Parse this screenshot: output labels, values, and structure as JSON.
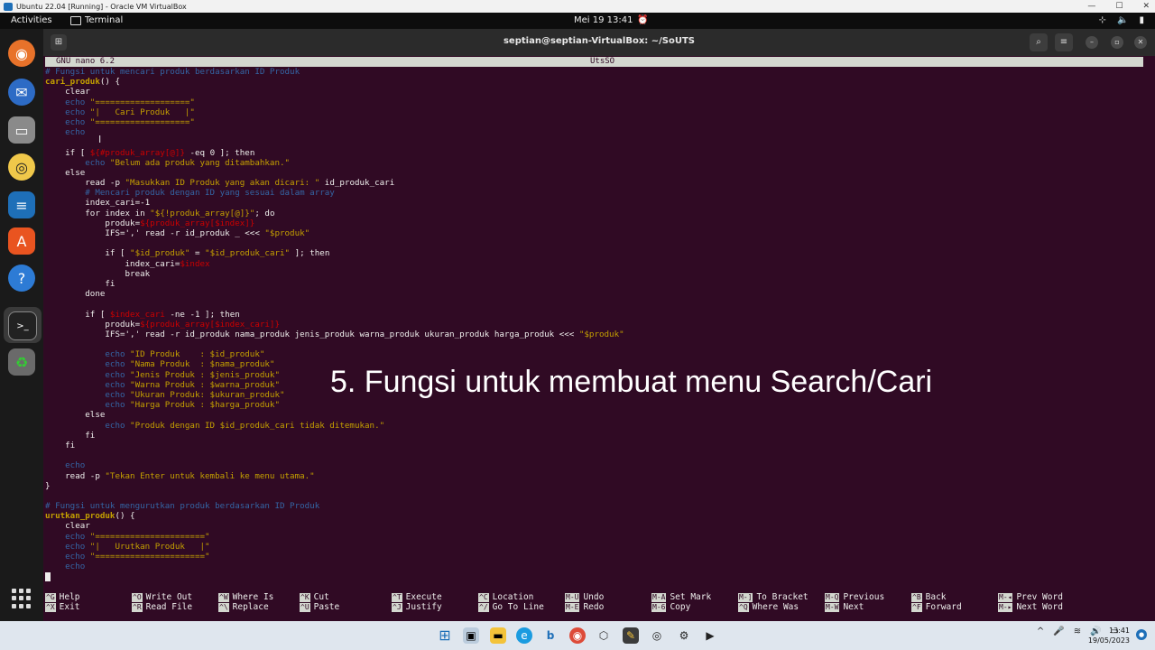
{
  "vbox": {
    "title": "Ubuntu 22.04 [Running] - Oracle VM VirtualBox",
    "minimize": "—",
    "restore": "☐",
    "close": "✕"
  },
  "topbar": {
    "activities": "Activities",
    "app_name": "Terminal",
    "clock": "Mei 19  13:41"
  },
  "terminal": {
    "title": "septian@septian-VirtualBox: ~/SoUTS"
  },
  "nano": {
    "version": "GNU nano 6.2",
    "filename": "UtsSO"
  },
  "editor_lines": [
    [
      [
        "c-cm",
        "# Fungsi untuk mencari produk berdasarkan ID Produk"
      ]
    ],
    [
      [
        "c-fn",
        "cari_produk"
      ],
      [
        "",
        "() {"
      ]
    ],
    [
      [
        "",
        "    clear"
      ]
    ],
    [
      [
        "c-echo",
        "    echo "
      ],
      [
        "c-str",
        "\"===================\""
      ]
    ],
    [
      [
        "c-echo",
        "    echo "
      ],
      [
        "c-str",
        "\"|   Cari Produk   |\""
      ]
    ],
    [
      [
        "c-echo",
        "    echo "
      ],
      [
        "c-str",
        "\"===================\""
      ]
    ],
    [
      [
        "c-echo",
        "    echo"
      ]
    ],
    [
      [
        "",
        ""
      ]
    ],
    [
      [
        "",
        "    if [ "
      ],
      [
        "c-var",
        "${#produk_array[@]}"
      ],
      [
        "",
        " -eq 0 ]; then"
      ]
    ],
    [
      [
        "c-echo",
        "        echo "
      ],
      [
        "c-str",
        "\"Belum ada produk yang ditambahkan.\""
      ]
    ],
    [
      [
        "",
        "    else"
      ]
    ],
    [
      [
        "",
        "        read -p "
      ],
      [
        "c-str",
        "\"Masukkan ID Produk yang akan dicari: \""
      ],
      [
        "",
        " id_produk_cari"
      ]
    ],
    [
      [
        "c-cm",
        "        # Mencari produk dengan ID yang sesuai dalam array"
      ]
    ],
    [
      [
        "",
        "        index_cari=-1"
      ]
    ],
    [
      [
        "",
        "        for index in "
      ],
      [
        "c-str",
        "\"${!produk_array[@]}\""
      ],
      [
        "",
        "; do"
      ]
    ],
    [
      [
        "",
        "            produk="
      ],
      [
        "c-var",
        "${produk_array[$index]}"
      ]
    ],
    [
      [
        "",
        "            IFS=',' read -r id_produk _ <<< "
      ],
      [
        "c-str",
        "\"$produk\""
      ]
    ],
    [
      [
        "",
        ""
      ]
    ],
    [
      [
        "",
        "            if [ "
      ],
      [
        "c-str",
        "\"$id_produk\""
      ],
      [
        "",
        " = "
      ],
      [
        "c-str",
        "\"$id_produk_cari\""
      ],
      [
        "",
        " ]; then"
      ]
    ],
    [
      [
        "",
        "                index_cari="
      ],
      [
        "c-var",
        "$index"
      ]
    ],
    [
      [
        "",
        "                break"
      ]
    ],
    [
      [
        "",
        "            fi"
      ]
    ],
    [
      [
        "",
        "        done"
      ]
    ],
    [
      [
        "",
        ""
      ]
    ],
    [
      [
        "",
        "        if [ "
      ],
      [
        "c-var",
        "$index_cari"
      ],
      [
        "",
        " -ne -1 ]; then"
      ]
    ],
    [
      [
        "",
        "            produk="
      ],
      [
        "c-var",
        "${produk_array[$index_cari]}"
      ]
    ],
    [
      [
        "",
        "            IFS=',' read -r id_produk nama_produk jenis_produk warna_produk ukuran_produk harga_produk <<< "
      ],
      [
        "c-str",
        "\"$produk\""
      ]
    ],
    [
      [
        "",
        ""
      ]
    ],
    [
      [
        "c-echo",
        "            echo "
      ],
      [
        "c-str",
        "\"ID Produk    : $id_produk\""
      ]
    ],
    [
      [
        "c-echo",
        "            echo "
      ],
      [
        "c-str",
        "\"Nama Produk  : $nama_produk\""
      ]
    ],
    [
      [
        "c-echo",
        "            echo "
      ],
      [
        "c-str",
        "\"Jenis Produk : $jenis_produk\""
      ]
    ],
    [
      [
        "c-echo",
        "            echo "
      ],
      [
        "c-str",
        "\"Warna Produk : $warna_produk\""
      ]
    ],
    [
      [
        "c-echo",
        "            echo "
      ],
      [
        "c-str",
        "\"Ukuran Produk: $ukuran_produk\""
      ]
    ],
    [
      [
        "c-echo",
        "            echo "
      ],
      [
        "c-str",
        "\"Harga Produk : $harga_produk\""
      ]
    ],
    [
      [
        "",
        "        else"
      ]
    ],
    [
      [
        "c-echo",
        "            echo "
      ],
      [
        "c-str",
        "\"Produk dengan ID $id_produk_cari tidak ditemukan.\""
      ]
    ],
    [
      [
        "",
        "        fi"
      ]
    ],
    [
      [
        "",
        "    fi"
      ]
    ],
    [
      [
        "",
        ""
      ]
    ],
    [
      [
        "c-echo",
        "    echo"
      ]
    ],
    [
      [
        "",
        "    read -p "
      ],
      [
        "c-str",
        "\"Tekan Enter untuk kembali ke menu utama.\""
      ]
    ],
    [
      [
        "",
        "}"
      ]
    ],
    [
      [
        "",
        ""
      ]
    ],
    [
      [
        "c-cm",
        "# Fungsi untuk mengurutkan produk berdasarkan ID Produk"
      ]
    ],
    [
      [
        "c-fn",
        "urutkan_produk"
      ],
      [
        "",
        "() {"
      ]
    ],
    [
      [
        "",
        "    clear"
      ]
    ],
    [
      [
        "c-echo",
        "    echo "
      ],
      [
        "c-str",
        "\"======================\""
      ]
    ],
    [
      [
        "c-echo",
        "    echo "
      ],
      [
        "c-str",
        "\"|   Urutkan Produk   |\""
      ]
    ],
    [
      [
        "c-echo",
        "    echo "
      ],
      [
        "c-str",
        "\"======================\""
      ]
    ],
    [
      [
        "c-echo",
        "    echo"
      ]
    ]
  ],
  "overlay_caption": "5. Fungsi untuk membuat menu Search/Cari",
  "shortcuts": [
    {
      "k1": "^G",
      "l1": "Help",
      "k2": "^X",
      "l2": "Exit"
    },
    {
      "k1": "^O",
      "l1": "Write Out",
      "k2": "^R",
      "l2": "Read File"
    },
    {
      "k1": "^W",
      "l1": "Where Is",
      "k2": "^\\",
      "l2": "Replace"
    },
    {
      "k1": "^K",
      "l1": "Cut",
      "k2": "^U",
      "l2": "Paste"
    },
    {
      "k1": "^T",
      "l1": "Execute",
      "k2": "^J",
      "l2": "Justify"
    },
    {
      "k1": "^C",
      "l1": "Location",
      "k2": "^/",
      "l2": "Go To Line"
    },
    {
      "k1": "M-U",
      "l1": "Undo",
      "k2": "M-E",
      "l2": "Redo"
    },
    {
      "k1": "M-A",
      "l1": "Set Mark",
      "k2": "M-6",
      "l2": "Copy"
    },
    {
      "k1": "M-]",
      "l1": "To Bracket",
      "k2": "^Q",
      "l2": "Where Was"
    },
    {
      "k1": "M-Q",
      "l1": "Previous",
      "k2": "M-W",
      "l2": "Next"
    },
    {
      "k1": "^B",
      "l1": "Back",
      "k2": "^F",
      "l2": "Forward"
    },
    {
      "k1": "M-◂",
      "l1": "Prev Word",
      "k2": "M-▸",
      "l2": "Next Word"
    }
  ],
  "taskbar": {
    "time": "13:41",
    "date": "19/05/2023"
  },
  "colors": {
    "terminal_bg": "#300a24",
    "comment": "#3465a4",
    "string": "#c4a000",
    "variable": "#cc0000"
  }
}
